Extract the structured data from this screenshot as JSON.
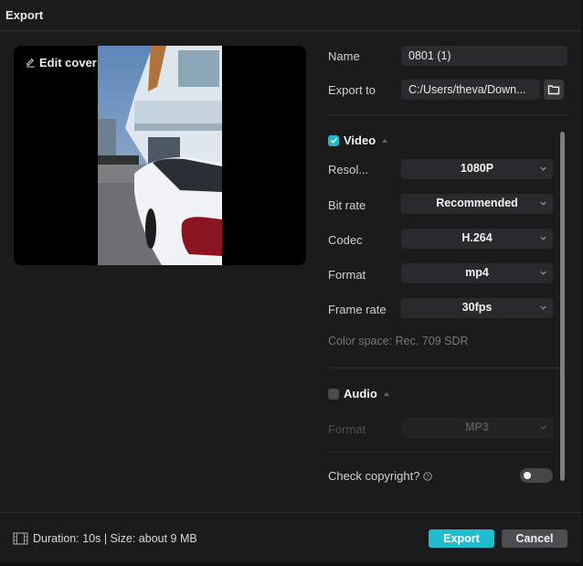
{
  "window": {
    "title": "Export"
  },
  "preview": {
    "edit_cover_label": "Edit cover"
  },
  "form": {
    "name_label": "Name",
    "name_value": "0801 (1)",
    "export_to_label": "Export to",
    "export_to_value": "C:/Users/theva/Down..."
  },
  "video": {
    "section_label": "Video",
    "enabled": true,
    "rows": [
      {
        "label": "Resol...",
        "value": "1080P"
      },
      {
        "label": "Bit rate",
        "value": "Recommended"
      },
      {
        "label": "Codec",
        "value": "H.264"
      },
      {
        "label": "Format",
        "value": "mp4"
      },
      {
        "label": "Frame rate",
        "value": "30fps"
      }
    ],
    "color_space": "Color space: Rec. 709 SDR"
  },
  "audio": {
    "section_label": "Audio",
    "enabled": false,
    "format_label": "Format",
    "format_value": "MP3"
  },
  "copyright": {
    "label": "Check copyright?",
    "enabled": false
  },
  "footer": {
    "info": "Duration: 10s | Size: about 9 MB",
    "export_label": "Export",
    "cancel_label": "Cancel"
  },
  "colors": {
    "accent": "#1fbdd0",
    "background": "#1b1b1c",
    "field": "#2b2b2f"
  }
}
